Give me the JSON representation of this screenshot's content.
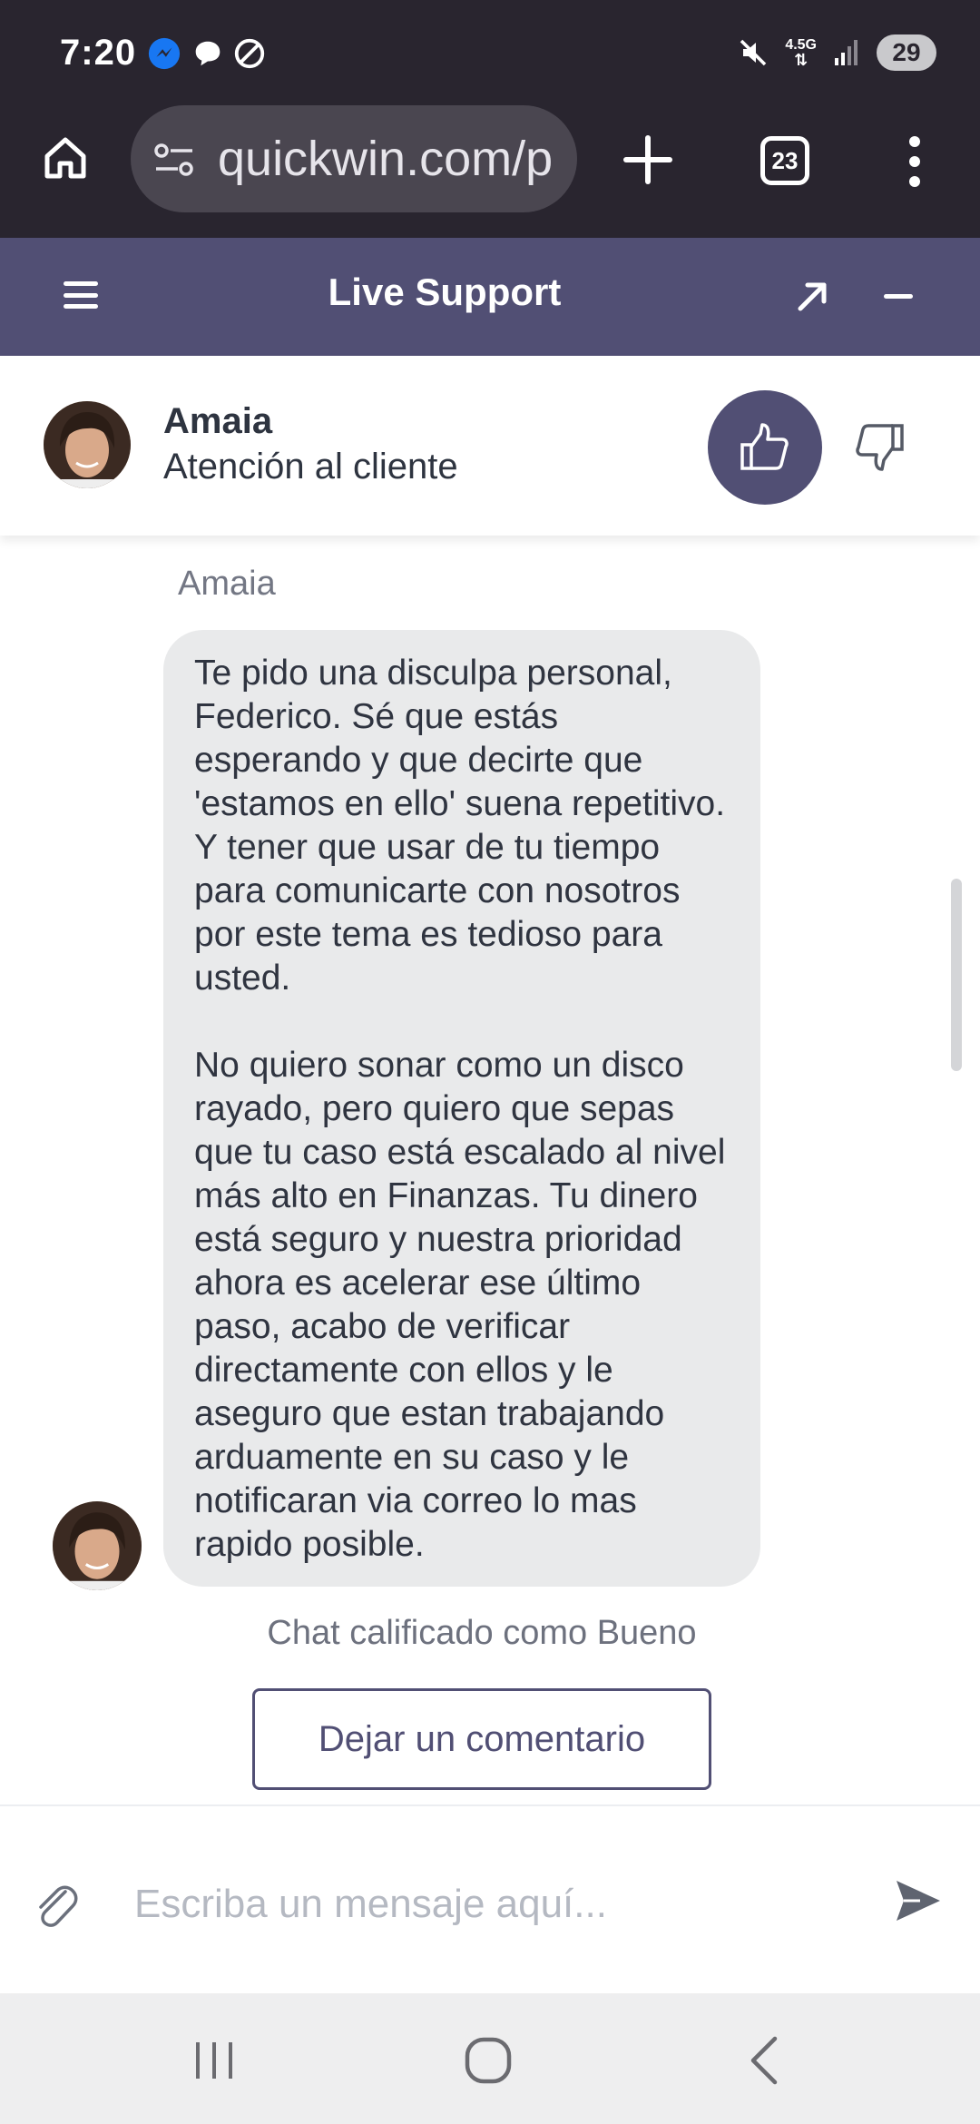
{
  "status_bar": {
    "time": "7:20",
    "network": "4.5G",
    "battery": "29",
    "icons": [
      "facebook-messenger-icon",
      "chat-bubble-icon",
      "do-not-disturb-icon",
      "mute-icon",
      "signal-icon"
    ]
  },
  "browser": {
    "url": "quickwin.com/p",
    "tab_count": "23",
    "icons": [
      "home-icon",
      "site-settings-icon",
      "new-tab-plus-icon",
      "tabs-icon",
      "more-vert-icon"
    ]
  },
  "header": {
    "title": "Live Support",
    "color": "#514f74"
  },
  "agent": {
    "name": "Amaia",
    "role": "Atención al cliente"
  },
  "chat": {
    "sender": "Amaia",
    "message": "Te pido una disculpa personal, Federico. Sé que estás esperando y que decirte que 'estamos en ello' suena repetitivo. Y tener que usar de tu tiempo para comunicarte con nosotros por este tema es tedioso para usted.\n\nNo quiero sonar como un disco rayado, pero quiero que sepas que tu caso está escalado al nivel más alto en Finanzas. Tu dinero está seguro y nuestra prioridad ahora es acelerar ese último paso, acabo de verificar directamente con ellos y le aseguro que estan trabajando arduamente en su caso y le notificaran via correo lo mas rapido posible.",
    "rating_text": "Chat calificado como Bueno",
    "comment_button": "Dejar un comentario"
  },
  "composer": {
    "placeholder": "Escriba un mensaje aquí...",
    "value": ""
  }
}
